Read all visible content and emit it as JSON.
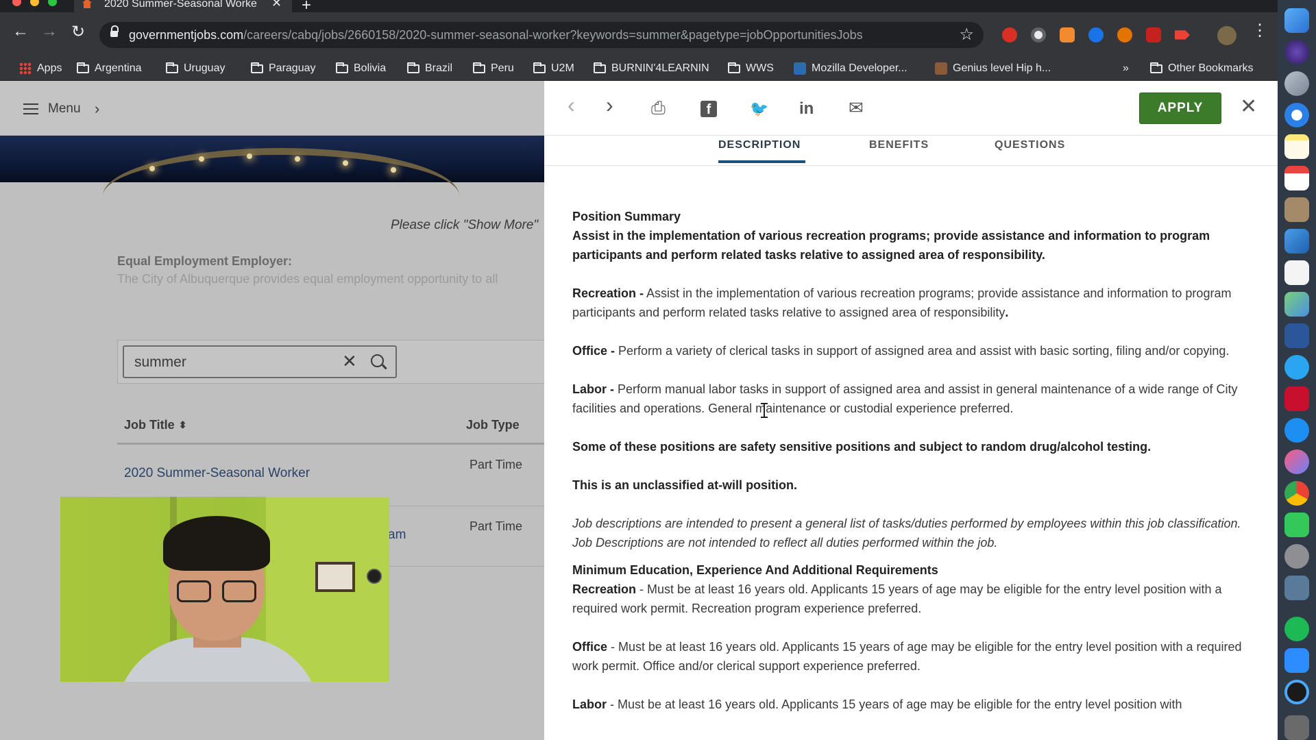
{
  "browser": {
    "tab_title": "2020 Summer-Seasonal Worke",
    "tab_close": "✕",
    "new_tab": "+",
    "url_domain": "governmentjobs.com",
    "url_path": "/careers/cabq/jobs/2660158/2020-summer-seasonal-worker?keywords=summer&pagetype=jobOpportunitiesJobs",
    "back": "←",
    "forward": "→",
    "reload": "↻",
    "star": "☆",
    "more_menu": "⋮",
    "bookmarks_overflow": "»",
    "bookmarks": [
      "Apps",
      "Argentina",
      "Uruguay",
      "Paraguay",
      "Bolivia",
      "Brazil",
      "Peru",
      "U2M",
      "BURNIN'4LEARNIN",
      "WWS",
      "Mozilla Developer...",
      "Genius level Hip h...",
      "Other Bookmarks"
    ]
  },
  "left_page": {
    "menu_label": "Menu",
    "menu_chevron": "›",
    "show_more_note": "Please click \"Show More\"",
    "eeo_title": "Equal Employment Employer:",
    "eeo_text": "The City of Albuquerque provides equal employment opportunity to all",
    "search_value": "summer",
    "search_clear": "✕",
    "columns": {
      "title": "Job Title",
      "sort": "⬍",
      "type": "Job Type"
    },
    "jobs": [
      {
        "title": "2020 Summer-Seasonal Worker",
        "type": "Part Time"
      },
      {
        "title": "am",
        "type": "Part Time"
      }
    ]
  },
  "panel": {
    "prev": "‹",
    "next": "›",
    "print_icon": "⎙",
    "facebook_icon": "f",
    "twitter_icon": "🐦",
    "linkedin_icon": "in",
    "email_icon": "✉",
    "apply_label": "APPLY",
    "close": "✕",
    "tabs": [
      "DESCRIPTION",
      "BENEFITS",
      "QUESTIONS"
    ],
    "description": {
      "position_summary_heading": "Position Summary",
      "position_summary": "Assist in the implementation of various recreation programs; provide assistance and information to program participants and perform related tasks relative to assigned area of responsibility.",
      "recreation_label": "Recreation -",
      "recreation_text": " Assist in the implementation of various recreation programs; provide assistance and information to program participants and perform related tasks relative to assigned area of responsibility",
      "recreation_period": ".",
      "office_label": "Office -",
      "office_text": " Perform a variety of clerical tasks in support of assigned area and assist with basic sorting, filing and/or copying.",
      "labor_label": "Labor -",
      "labor_text": " Perform manual labor tasks in support of assigned area and assist in general maintenance of a wide range of City facilities and operations.  General maintenance or custodial experience preferred.",
      "safety_note": "Some of these positions are safety sensitive positions and subject to random drug/alcohol testing.",
      "at_will_note": "This is an unclassified at-will position.",
      "disclaimer": "Job descriptions are intended to present a general list of tasks/duties performed by employees within this job classification. Job Descriptions are not intended to reflect all duties performed within the job.",
      "min_req_heading": "Minimum Education, Experience And Additional Requirements",
      "req_recreation_label": "Recreation",
      "req_recreation_text": " - Must be at least 16 years old.  Applicants 15 years of age may be eligible for the entry level position with a required work permit. Recreation program experience preferred.",
      "req_office_label": "Office",
      "req_office_text": " - Must be at least 16 years old.  Applicants 15 years of age may be eligible for the entry level position with a required work permit.  Office and/or clerical support experience preferred.",
      "req_labor_label": "Labor",
      "req_labor_text": " - Must be at least 16 years old.  Applicants 15 years of age may be eligible for the entry level position with"
    }
  },
  "colors": {
    "apply_green": "#3b7b2a",
    "link_blue": "#284268",
    "tab_underline": "#1e4e7a",
    "chrome_dark": "#35363a"
  }
}
